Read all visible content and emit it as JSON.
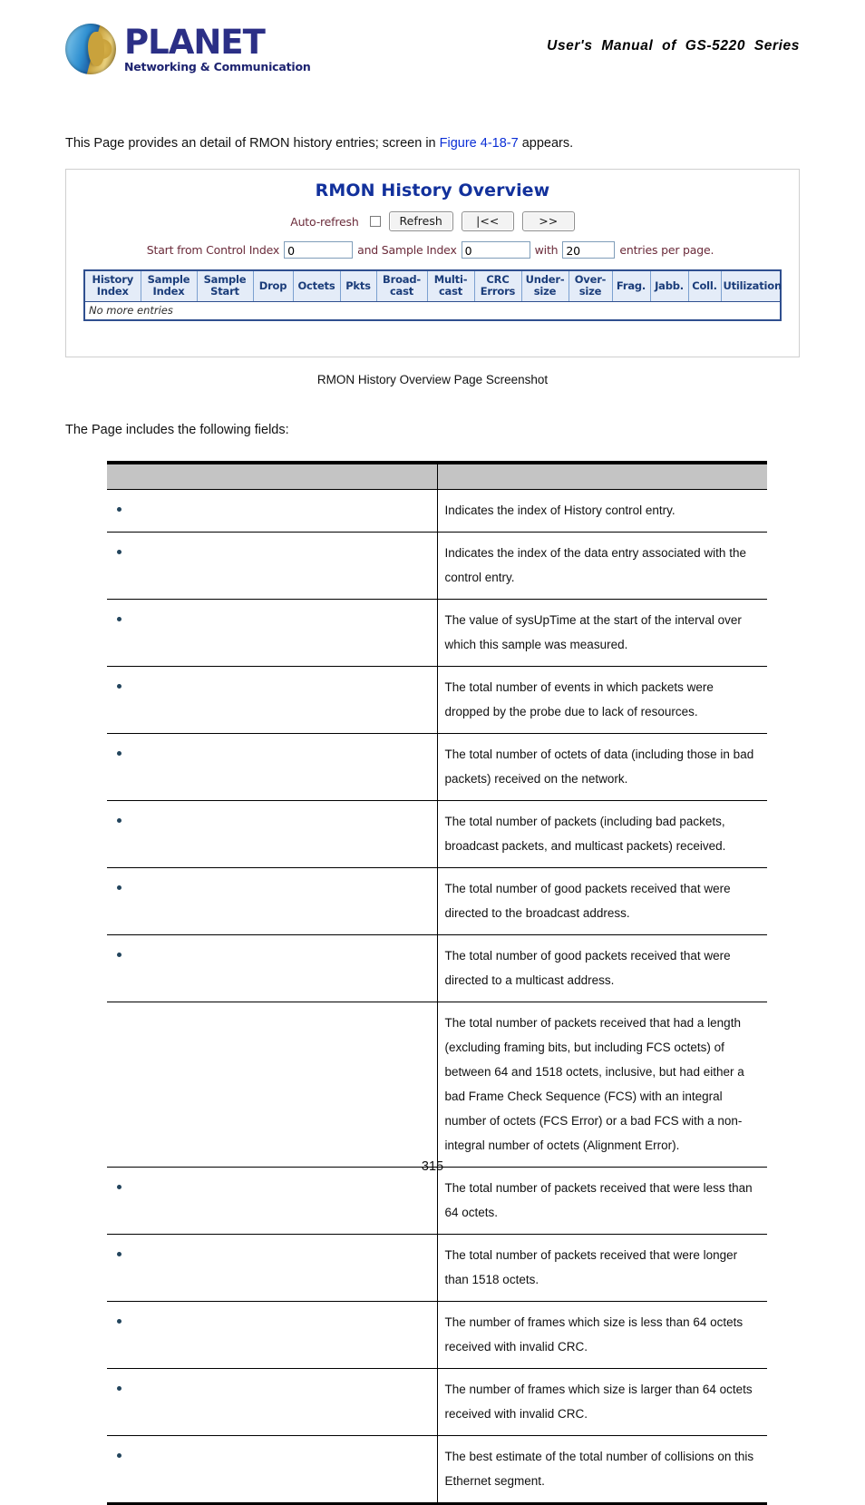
{
  "header": {
    "logo_word": "PLANET",
    "logo_tagline": "Networking & Communication",
    "manual_title": "User's  Manual  of  GS-5220  Series"
  },
  "intro": {
    "text_before": "This Page provides an detail of RMON history entries; screen in ",
    "figure_link": "Figure 4-18-7",
    "text_after": " appears."
  },
  "screenshot": {
    "title": "RMON History Overview",
    "toolbar": {
      "auto_refresh_label": "Auto-refresh",
      "auto_refresh_checked": false,
      "refresh_button": "Refresh",
      "first_button": "|<<",
      "next_button": ">>"
    },
    "range": {
      "label_start": "Start from Control Index",
      "control_index_value": "0",
      "label_and": "and Sample Index",
      "sample_index_value": "0",
      "label_with": "with",
      "entries_value": "20",
      "label_tail": "entries per page."
    },
    "table": {
      "columns": [
        "History\nIndex",
        "Sample\nIndex",
        "Sample\nStart",
        "Drop",
        "Octets",
        "Pkts",
        "Broad-\ncast",
        "Multi-\ncast",
        "CRC\nErrors",
        "Under-\nsize",
        "Over-\nsize",
        "Frag.",
        "Jabb.",
        "Coll.",
        "Utilization"
      ],
      "empty_message": "No more entries"
    }
  },
  "caption": "RMON History Overview Page Screenshot",
  "fields_intro": "The Page includes the following fields:",
  "fields_table": {
    "header": {
      "object": "",
      "description": ""
    },
    "rows": [
      {
        "name": "",
        "bullet": true,
        "description": "Indicates the index of History control entry."
      },
      {
        "name": "",
        "bullet": true,
        "description": "Indicates the index of the data entry associated with the control entry."
      },
      {
        "name": "",
        "bullet": true,
        "description": "The value of sysUpTime at the start of the interval over which this sample was measured."
      },
      {
        "name": "",
        "bullet": true,
        "description": "The total number of events in which packets were dropped by the probe due to lack of resources."
      },
      {
        "name": "",
        "bullet": true,
        "description": "The total number of octets of data (including those in bad packets) received on the network."
      },
      {
        "name": "",
        "bullet": true,
        "description": "The total number of packets (including bad packets, broadcast packets, and multicast packets) received."
      },
      {
        "name": "",
        "bullet": true,
        "description": "The total number of good packets received that were directed to the broadcast address."
      },
      {
        "name": "",
        "bullet": true,
        "description": "The total number of good packets received that were directed to a multicast address."
      },
      {
        "name": "",
        "bullet": false,
        "description": "The total number of packets received that had a length (excluding framing bits, but including FCS octets) of between 64 and 1518 octets, inclusive, but had either a bad Frame Check Sequence (FCS) with an integral number of octets (FCS Error) or a bad FCS with a non-integral number of octets (Alignment Error)."
      },
      {
        "name": "",
        "bullet": true,
        "description": "The total number of packets received that were less than 64 octets."
      },
      {
        "name": "",
        "bullet": true,
        "description": "The total number of packets received that were longer than 1518 octets."
      },
      {
        "name": "",
        "bullet": true,
        "description": "The number of frames which size is less than 64 octets received with invalid CRC."
      },
      {
        "name": "",
        "bullet": true,
        "description": "The number of frames which size is larger than 64 octets received with invalid CRC."
      },
      {
        "name": "",
        "bullet": true,
        "description": "The best estimate of the total number of collisions on this Ethernet segment."
      }
    ]
  },
  "footer": {
    "page_number": "315"
  }
}
